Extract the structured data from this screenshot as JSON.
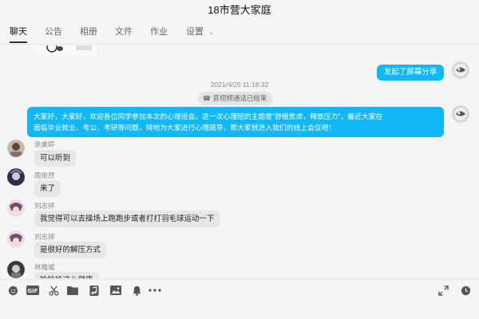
{
  "window": {
    "title": "18市营大家庭"
  },
  "tabs": [
    {
      "label": "聊天",
      "active": true
    },
    {
      "label": "公告"
    },
    {
      "label": "相册"
    },
    {
      "label": "文件"
    },
    {
      "label": "作业"
    },
    {
      "label": "设置"
    }
  ],
  "messages": {
    "screen_share": "发起了屏幕分享",
    "timestamp": "2021/4/29 11:18:32",
    "call_ended": "音视频通话已结束",
    "announcement_line1": "大家好，大家好，欢迎各位同学参加本次的心理班会。这一次心理班的主题是\"舒缓焦虑，释放压力\"，最近大家在",
    "announcement_line2": "面临毕业就业、考公、考研等问题，特地为大家进行心理疏导，那大家就进入我们的线上会议吧！",
    "m1": {
      "sender": "余美婷",
      "text": "可以听到"
    },
    "m2": {
      "sender": "周依然",
      "text": "来了"
    },
    "m3": {
      "sender": "刘志祥",
      "text": "我觉得可以去操场上跑跑步或者打打羽毛球运动一下"
    },
    "m4": {
      "sender": "刘志祥",
      "text": "是很好的解压方式"
    },
    "m5": {
      "sender": "林雅威",
      "text": "哈哈哈这么健康"
    }
  },
  "toolbar": {
    "left_tools": [
      "emoji-icon",
      "gif-icon",
      "scissors-icon",
      "folder-icon",
      "music-icon",
      "image-icon",
      "bell-icon",
      "more-icon"
    ],
    "right_tools": [
      "expand-icon",
      "history-clock-icon"
    ]
  },
  "colors": {
    "accent_blue": "#12b7f5",
    "bubble_gray": "#e7e7e7",
    "background": "#f5f5f5"
  }
}
